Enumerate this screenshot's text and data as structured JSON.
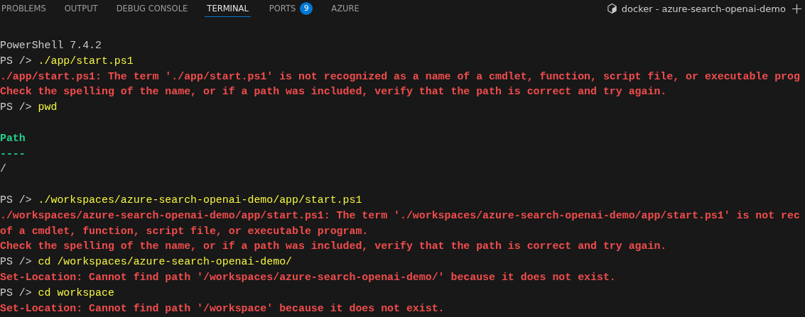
{
  "tabs": [
    {
      "label": "PROBLEMS",
      "selected": false
    },
    {
      "label": "OUTPUT",
      "selected": false
    },
    {
      "label": "DEBUG CONSOLE",
      "selected": false
    },
    {
      "label": "TERMINAL",
      "selected": true
    },
    {
      "label": "PORTS",
      "selected": false,
      "badge": "9"
    },
    {
      "label": "AZURE",
      "selected": false
    }
  ],
  "terminal_selector": {
    "label": "docker - azure-search-openai-demo"
  },
  "terminal": {
    "lines": [
      {
        "kind": "text",
        "segments": [
          {
            "kind": "plain",
            "text": "PowerShell 7.4.2"
          }
        ]
      },
      {
        "kind": "text",
        "segments": [
          {
            "kind": "prompt",
            "text": "PS />"
          },
          {
            "kind": "command",
            "text": "./app/start.ps1"
          }
        ]
      },
      {
        "kind": "text",
        "segments": [
          {
            "kind": "error",
            "text": "./app/start.ps1: The term './app/start.ps1' is not recognized as a name of a cmdlet, function, script file, or executable prog"
          }
        ]
      },
      {
        "kind": "text",
        "segments": [
          {
            "kind": "error",
            "text": "Check the spelling of the name, or if a path was included, verify that the path is correct and try again."
          }
        ]
      },
      {
        "kind": "text",
        "segments": [
          {
            "kind": "prompt",
            "text": "PS />"
          },
          {
            "kind": "command",
            "text": "pwd"
          }
        ]
      },
      {
        "kind": "blank"
      },
      {
        "kind": "text",
        "segments": [
          {
            "kind": "header",
            "text": "Path"
          }
        ]
      },
      {
        "kind": "text",
        "segments": [
          {
            "kind": "header",
            "text": "----"
          }
        ]
      },
      {
        "kind": "text",
        "segments": [
          {
            "kind": "plain",
            "text": "/"
          }
        ]
      },
      {
        "kind": "blank"
      },
      {
        "kind": "text",
        "segments": [
          {
            "kind": "prompt",
            "text": "PS />"
          },
          {
            "kind": "command",
            "text": "./workspaces/azure-search-openai-demo/app/start.ps1"
          }
        ]
      },
      {
        "kind": "text",
        "segments": [
          {
            "kind": "error",
            "text": "./workspaces/azure-search-openai-demo/app/start.ps1: The term './workspaces/azure-search-openai-demo/app/start.ps1' is not rec"
          }
        ]
      },
      {
        "kind": "text",
        "segments": [
          {
            "kind": "error",
            "text": "of a cmdlet, function, script file, or executable program."
          }
        ]
      },
      {
        "kind": "text",
        "segments": [
          {
            "kind": "error",
            "text": "Check the spelling of the name, or if a path was included, verify that the path is correct and try again."
          }
        ]
      },
      {
        "kind": "text",
        "segments": [
          {
            "kind": "prompt",
            "text": "PS />"
          },
          {
            "kind": "command",
            "text": "cd /workspaces/azure-search-openai-demo/"
          }
        ]
      },
      {
        "kind": "text",
        "segments": [
          {
            "kind": "error",
            "text": "Set-Location: Cannot find path '/workspaces/azure-search-openai-demo/' because it does not exist."
          }
        ]
      },
      {
        "kind": "text",
        "segments": [
          {
            "kind": "prompt",
            "text": "PS />"
          },
          {
            "kind": "command",
            "text": "cd workspace"
          }
        ]
      },
      {
        "kind": "text",
        "segments": [
          {
            "kind": "error",
            "text": "Set-Location: Cannot find path '/workspace' because it does not exist."
          }
        ]
      }
    ]
  }
}
